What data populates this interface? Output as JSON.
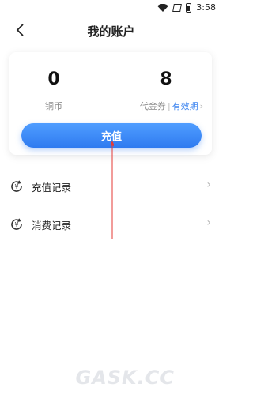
{
  "status_bar": {
    "time": "3:58"
  },
  "header": {
    "title": "我的账户"
  },
  "account": {
    "coins_value": "0",
    "coins_label": "铜币",
    "voucher_value": "8",
    "voucher_label": "代金券",
    "voucher_separator": "|",
    "validity_link": "有效期",
    "recharge_button": "充值"
  },
  "menu": {
    "items": [
      {
        "label": "充值记录",
        "icon": "coin-refresh-icon"
      },
      {
        "label": "消费记录",
        "icon": "coin-refresh-icon"
      }
    ]
  },
  "watermark": "GASK.CC",
  "colors": {
    "accent": "#2f7bf0",
    "arrow": "#e53935",
    "link": "#3f86f0"
  }
}
